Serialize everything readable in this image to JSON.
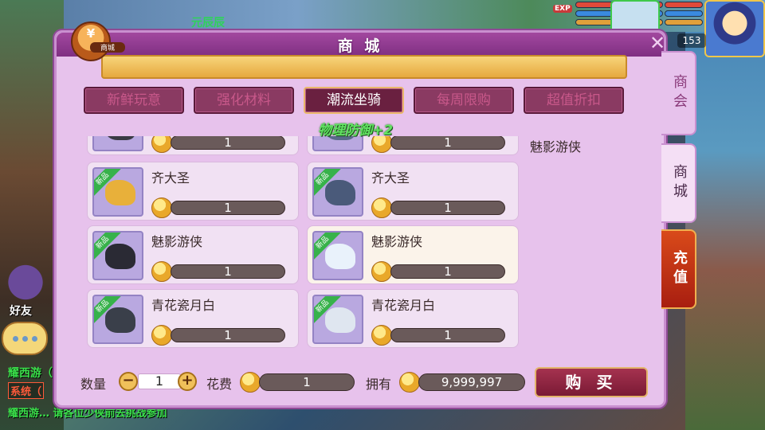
{
  "scene": {
    "top_name": "元辰辰",
    "exp_badge": "EXP",
    "hero_level": "153",
    "friends_label": "好友",
    "chat_line1": "耀西游（",
    "chat_system": "系统（",
    "chat_line2": "耀西游… 请各位少侠前去挑战参加"
  },
  "panel": {
    "title": "商 城",
    "close": "✕",
    "logo_symbol": "¥",
    "logo_label": "商城",
    "tabs": [
      {
        "label": "新鲜玩意",
        "active": false
      },
      {
        "label": "强化材料",
        "active": false
      },
      {
        "label": "潮流坐骑",
        "active": true
      },
      {
        "label": "每周限购",
        "active": false
      },
      {
        "label": "超值折扣",
        "active": false
      }
    ],
    "attr_float": "物理防御+2",
    "items": [
      {
        "name": "",
        "price": "1",
        "new": false,
        "highlight": false,
        "mount_color": "#3a3a44"
      },
      {
        "name": "",
        "price": "1",
        "new": false,
        "highlight": false,
        "mount_color": "#5a6a8a"
      },
      {
        "name": "齐大圣",
        "price": "1",
        "new": true,
        "highlight": false,
        "mount_color": "#e8b03a"
      },
      {
        "name": "齐大圣",
        "price": "1",
        "new": true,
        "highlight": false,
        "mount_color": "#4a5a7a"
      },
      {
        "name": "魅影游侠",
        "price": "1",
        "new": true,
        "highlight": false,
        "mount_color": "#2a2a34"
      },
      {
        "name": "魅影游侠",
        "price": "1",
        "new": true,
        "highlight": true,
        "mount_color": "#e9f2fb"
      },
      {
        "name": "青花瓷月白",
        "price": "1",
        "new": true,
        "highlight": false,
        "mount_color": "#3a3f4a"
      },
      {
        "name": "青花瓷月白",
        "price": "1",
        "new": true,
        "highlight": false,
        "mount_color": "#dfe6f0"
      }
    ],
    "new_tag": "新品",
    "preview_name": "魅影游侠",
    "footer": {
      "qty_label": "数量",
      "qty_minus": "−",
      "qty_value": "1",
      "qty_plus": "+",
      "cost_label": "花费",
      "cost_value": "1",
      "own_label": "拥有",
      "own_value": "9,999,997",
      "buy_label": "购 买"
    }
  },
  "side_tabs": {
    "guild": "商会",
    "mall": "商城",
    "recharge": "充值"
  }
}
